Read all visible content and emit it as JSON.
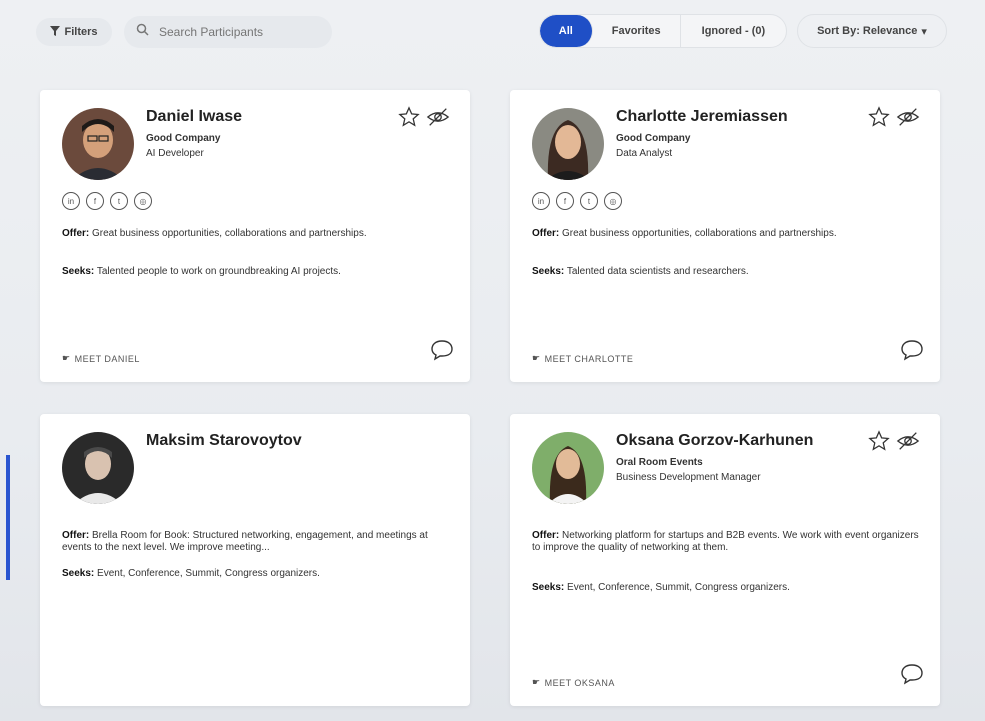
{
  "toolbar": {
    "filters_label": "Filters",
    "search_placeholder": "Search Participants",
    "tabs": [
      "All",
      "Favorites",
      "Ignored - (0)"
    ],
    "sort_label": "Sort By: Relevance"
  },
  "participants": [
    {
      "name": "Daniel Iwase",
      "company": "Good Company",
      "role": "AI Developer",
      "offer_label": "Offer:",
      "offer": "Great business opportunities, collaborations and partnerships.",
      "seeks_label": "Seeks:",
      "seeks": "Talented people to work on groundbreaking AI projects.",
      "meet_label": "MEET DANIEL"
    },
    {
      "name": "Charlotte Jeremiassen",
      "company": "Good Company",
      "role": "Data Analyst",
      "offer_label": "Offer:",
      "offer": "Great business opportunities, collaborations and partnerships.",
      "seeks_label": "Seeks:",
      "seeks": "Talented data scientists and researchers.",
      "meet_label": "MEET CHARLOTTE"
    },
    {
      "name": "Maksim Starovoytov",
      "company": "",
      "role": "",
      "offer_label": "Offer:",
      "offer": "Brella Room for Book: Structured networking, engagement, and meetings at events to the next level. We improve meeting...",
      "seeks_label": "Seeks:",
      "seeks": "Event, Conference, Summit, Congress organizers.",
      "meet_label": ""
    },
    {
      "name": "Oksana Gorzov-Karhunen",
      "company": "Oral Room Events",
      "role": "Business Development Manager",
      "offer_label": "Offer:",
      "offer": "Networking platform for startups and B2B events. We work with event organizers to improve the quality of networking at them.",
      "seeks_label": "Seeks:",
      "seeks": "Event, Conference, Summit, Congress organizers.",
      "meet_label": "MEET OKSANA"
    }
  ]
}
